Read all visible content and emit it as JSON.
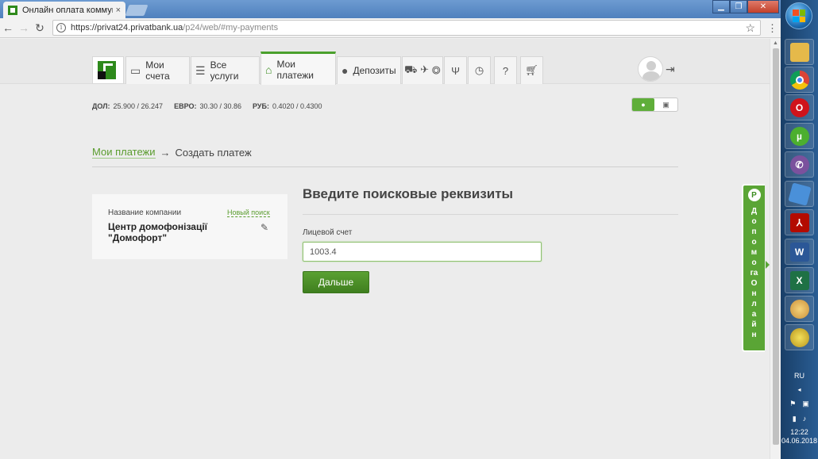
{
  "browser": {
    "tab_title": "Онлайн оплата коммуна",
    "tab_close": "×",
    "address": {
      "host": "https://privat24.privatbank.ua",
      "path": "/p24/web/#my-payments"
    },
    "window_controls": {
      "minimize": "▁",
      "restore": "❐",
      "close": "✕"
    }
  },
  "nav": {
    "items": [
      {
        "label": "Мои счета",
        "icon": "card-icon"
      },
      {
        "label": "Все услуги",
        "icon": "list-icon"
      },
      {
        "label": "Мои платежи",
        "icon": "home-icon"
      },
      {
        "label": "Депозиты",
        "icon": "piggy-icon"
      }
    ],
    "icon_tabs": [
      "transport-icon",
      "trident-icon",
      "clock-icon",
      "help-icon",
      "cart-icon"
    ]
  },
  "rates": {
    "usd": {
      "label": "ДОЛ:",
      "value": "25.900 / 26.247"
    },
    "eur": {
      "label": "ЕВРО:",
      "value": "30.30 / 30.86"
    },
    "rub": {
      "label": "РУБ:",
      "value": "0.4020 / 0.4300"
    }
  },
  "breadcrumb": {
    "link": "Мои платежи",
    "arrow": "→",
    "current": "Создать платеж"
  },
  "company_card": {
    "label": "Название компании",
    "new_search": "Новый поиск",
    "name": "Центр домофонізації \"Домофорт\""
  },
  "form": {
    "title": "Введите поисковые реквизиты",
    "account_label": "Лицевой счет",
    "account_value": "1003.4",
    "submit_label": "Дальше"
  },
  "help_widget": {
    "text": "Допомога Онлайн"
  },
  "taskbar": {
    "apps": [
      "explorer",
      "chrome",
      "opera",
      "utorrent",
      "viber",
      "virtualbox",
      "acrobat",
      "word",
      "excel",
      "paint",
      "coins"
    ],
    "language": "RU",
    "time": "12:22",
    "date": "04.06.2018"
  },
  "colors": {
    "accent": "#4aa02c",
    "link": "#5a9c2e",
    "button": "#4a8f27"
  }
}
